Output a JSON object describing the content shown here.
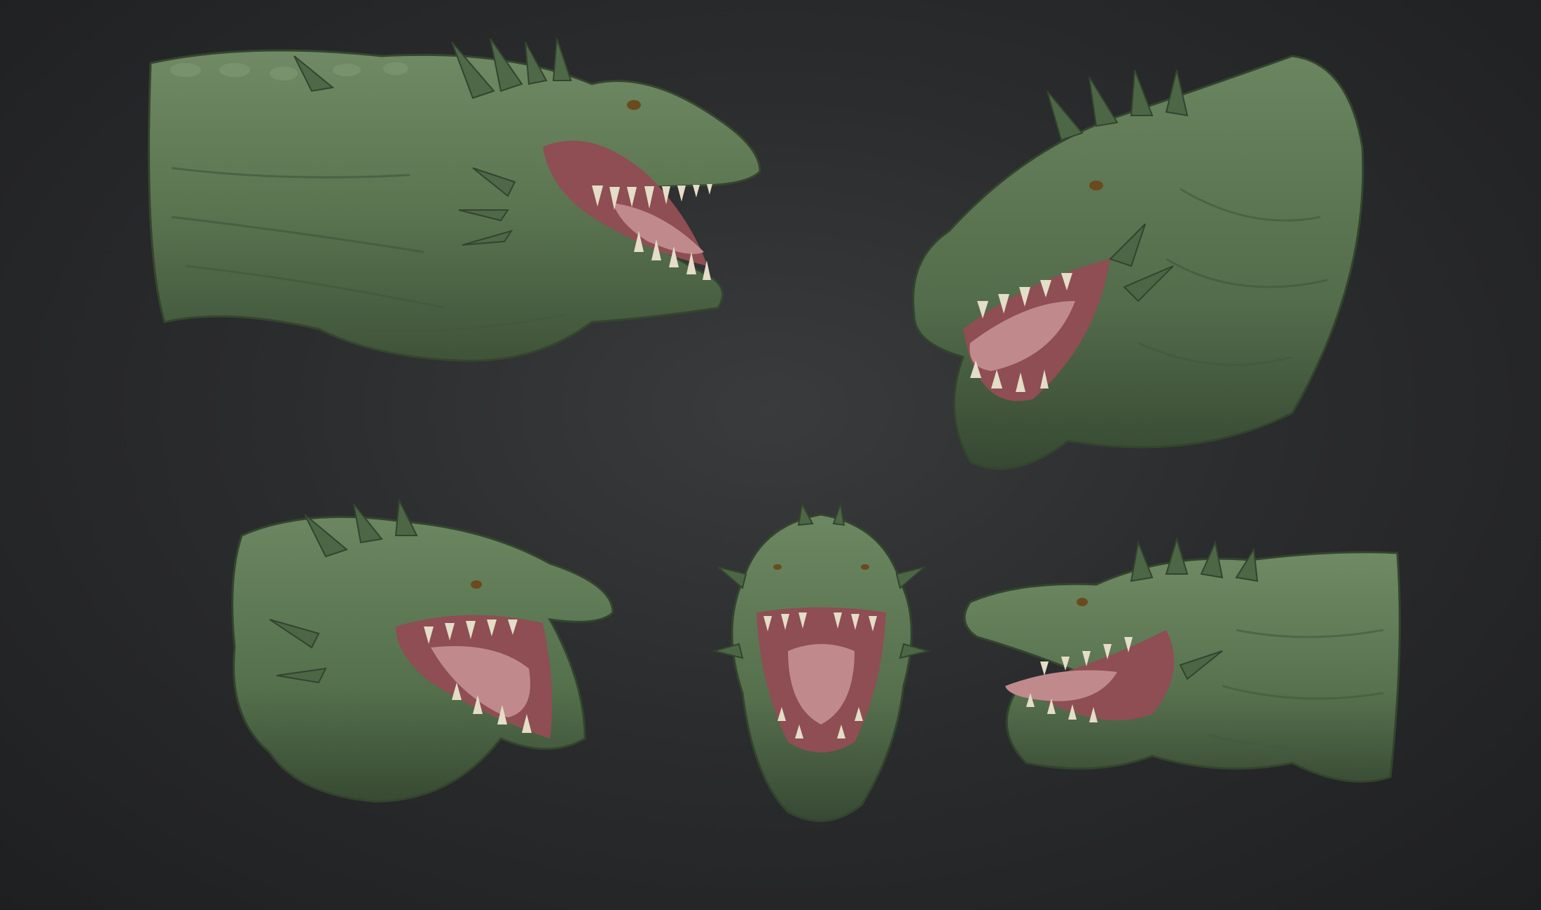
{
  "scene": {
    "background_color": "#2b2c2e",
    "skin_color": "#5f7a55",
    "skin_shadow_color": "#3b4d36",
    "skin_highlight_color": "#8fa784",
    "mouth_color": "#9a5a5e",
    "tongue_color": "#c08a8c",
    "teeth_color": "#e4ddc8",
    "eye_color": "#6b4a1f"
  },
  "views": [
    {
      "id": "side-left",
      "facing": "right",
      "pose": "profile"
    },
    {
      "id": "three-quarter-right",
      "facing": "left",
      "pose": "three-quarter"
    },
    {
      "id": "three-quarter-left-small",
      "facing": "right",
      "pose": "three-quarter"
    },
    {
      "id": "front",
      "facing": "viewer",
      "pose": "front"
    },
    {
      "id": "side-right-small",
      "facing": "left",
      "pose": "profile"
    }
  ]
}
